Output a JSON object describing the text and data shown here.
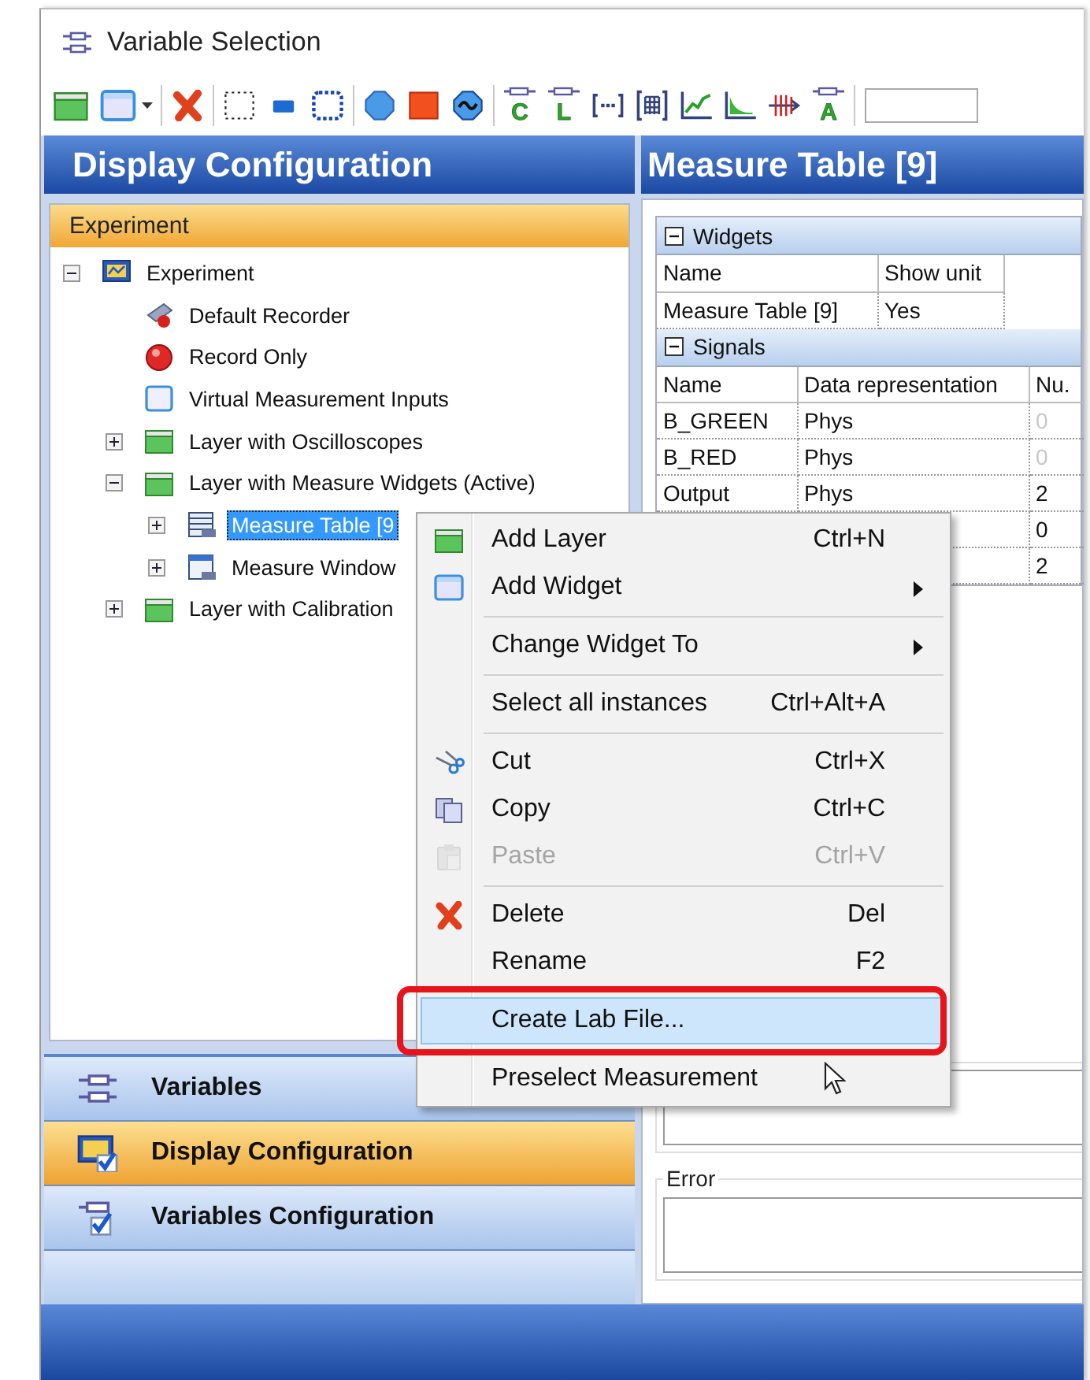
{
  "window": {
    "title": "Variable Selection"
  },
  "toolbar": {
    "groups": [
      [
        {
          "kind": "layer",
          "dropdown": false
        },
        {
          "kind": "widget",
          "dropdown": true
        }
      ],
      [
        {
          "kind": "delete",
          "dropdown": false
        }
      ],
      [
        {
          "kind": "dotted-rect",
          "dropdown": false
        },
        {
          "kind": "small-rect",
          "dropdown": false
        },
        {
          "kind": "dotted-frame",
          "dropdown": false
        }
      ],
      [
        {
          "kind": "octagon",
          "dropdown": false
        },
        {
          "kind": "square",
          "dropdown": false
        },
        {
          "kind": "wave",
          "dropdown": false
        }
      ],
      [
        {
          "kind": "variable",
          "letter": "C",
          "dropdown": false
        },
        {
          "kind": "variable",
          "letter": "L",
          "dropdown": false
        },
        {
          "kind": "bracket",
          "dropdown": false
        },
        {
          "kind": "grid",
          "dropdown": false
        },
        {
          "kind": "line-chart",
          "dropdown": false
        },
        {
          "kind": "area-chart",
          "dropdown": false
        },
        {
          "kind": "hatch",
          "dropdown": false
        },
        {
          "kind": "variable",
          "letter": "A",
          "dropdown": false
        }
      ]
    ]
  },
  "left_panel": {
    "title": "Display Configuration",
    "section": "Experiment",
    "tree": [
      {
        "label": "Experiment",
        "kind": "experiment",
        "expanded": true,
        "selected": false,
        "children": [
          {
            "label": "Default Recorder",
            "kind": "recorder",
            "selected": false
          },
          {
            "label": "Record Only",
            "kind": "record",
            "selected": false
          },
          {
            "label": "Virtual Measurement Inputs",
            "kind": "window",
            "selected": false
          },
          {
            "label": "Layer with Oscilloscopes",
            "kind": "layer",
            "expanded": false,
            "selected": false
          },
          {
            "label": "Layer with Measure Widgets (Active)",
            "kind": "layer",
            "expanded": true,
            "selected": false,
            "children": [
              {
                "label": "Measure Table [9",
                "kind": "table",
                "expanded": false,
                "selected": true
              },
              {
                "label": "Measure Window",
                "kind": "measure-window",
                "expanded": false,
                "selected": false
              }
            ]
          },
          {
            "label": "Layer with Calibration",
            "kind": "layer",
            "expanded": false,
            "selected": false
          }
        ]
      }
    ],
    "navigation": [
      {
        "label": "Variables",
        "kind": "variables",
        "selected": false
      },
      {
        "label": "Display Configuration",
        "kind": "display",
        "selected": true
      },
      {
        "label": "Variables Configuration",
        "kind": "var-config",
        "selected": false
      }
    ]
  },
  "right_panel": {
    "title": "Measure Table [9]",
    "groups": [
      {
        "title": "Widgets",
        "expanded": true,
        "columns": [
          "Name",
          "Show unit"
        ],
        "rows": [
          {
            "cells": [
              {
                "text": "Measure Table [9]",
                "dimmed": false
              },
              {
                "text": "Yes",
                "dimmed": false
              }
            ]
          }
        ]
      },
      {
        "title": "Signals",
        "expanded": true,
        "columns": [
          "Name",
          "Data representation",
          "Nu."
        ],
        "rows": [
          {
            "cells": [
              {
                "text": "B_GREEN",
                "dimmed": false
              },
              {
                "text": "Phys",
                "dimmed": false
              },
              {
                "text": "0",
                "dimmed": true
              }
            ]
          },
          {
            "cells": [
              {
                "text": "B_RED",
                "dimmed": false
              },
              {
                "text": "Phys",
                "dimmed": false
              },
              {
                "text": "0",
                "dimmed": true
              }
            ]
          },
          {
            "cells": [
              {
                "text": "Output",
                "dimmed": false
              },
              {
                "text": "Phys",
                "dimmed": false
              },
              {
                "text": "2",
                "dimmed": false
              }
            ]
          },
          {
            "cells": [
              null,
              null,
              {
                "text": "0",
                "dimmed": false
              }
            ]
          },
          {
            "cells": [
              null,
              null,
              {
                "text": "2",
                "dimmed": false
              }
            ]
          }
        ]
      }
    ],
    "boxes": [
      {
        "kind": "plain"
      },
      {
        "kind": "labeled",
        "label": "Error"
      }
    ]
  },
  "context_menu": {
    "groups": [
      [
        {
          "kind": "layer",
          "label": "Add Layer",
          "shortcut": "Ctrl+N",
          "submenu": false,
          "disabled": false,
          "selected": false,
          "outlined": false
        },
        {
          "kind": "widget",
          "label": "Add Widget",
          "submenu": true,
          "disabled": false,
          "selected": false,
          "outlined": false
        }
      ],
      [
        {
          "label": "Change Widget To",
          "submenu": true,
          "disabled": false,
          "selected": false,
          "outlined": false
        }
      ],
      [
        {
          "label": "Select all instances",
          "shortcut": "Ctrl+Alt+A",
          "submenu": false,
          "disabled": false,
          "selected": false,
          "outlined": false
        }
      ],
      [
        {
          "kind": "cut",
          "label": "Cut",
          "shortcut": "Ctrl+X",
          "submenu": false,
          "disabled": false,
          "selected": false,
          "outlined": false
        },
        {
          "kind": "copy",
          "label": "Copy",
          "shortcut": "Ctrl+C",
          "submenu": false,
          "disabled": false,
          "selected": false,
          "outlined": false
        },
        {
          "kind": "paste",
          "label": "Paste",
          "shortcut": "Ctrl+V",
          "submenu": false,
          "disabled": true,
          "selected": false,
          "outlined": false
        }
      ],
      [
        {
          "kind": "delete",
          "label": "Delete",
          "shortcut": "Del",
          "submenu": false,
          "disabled": false,
          "selected": false,
          "outlined": false
        },
        {
          "label": "Rename",
          "shortcut": "F2",
          "submenu": false,
          "disabled": false,
          "selected": false,
          "outlined": false
        }
      ],
      [
        {
          "label": "Create Lab File...",
          "submenu": false,
          "disabled": false,
          "selected": true,
          "outlined": true
        }
      ],
      [
        {
          "label": "Preselect Measurement",
          "submenu": false,
          "disabled": false,
          "selected": false,
          "outlined": false
        }
      ]
    ]
  }
}
